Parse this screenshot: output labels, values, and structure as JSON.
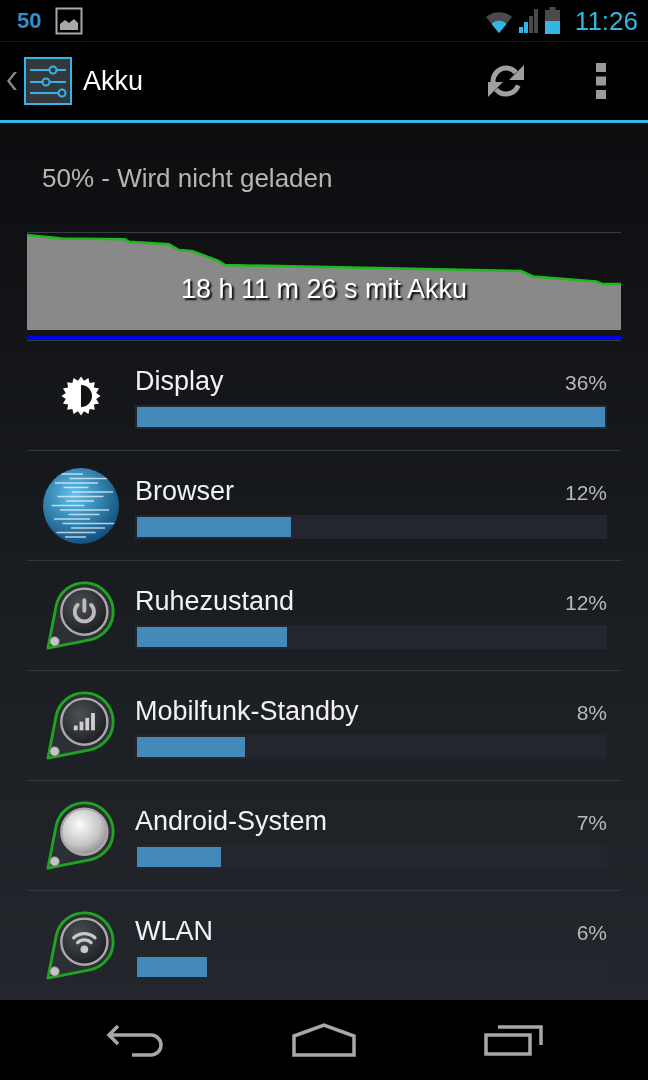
{
  "status_bar": {
    "notification": "50",
    "time": "11:26"
  },
  "action_bar": {
    "title": "Akku"
  },
  "battery": {
    "status": "50% - Wird nicht geladen",
    "graph_caption": "18 h 11 m 26 s mit Akku"
  },
  "usage": [
    {
      "kind": "display",
      "name": "Display",
      "percent": "36%",
      "level": 1.0
    },
    {
      "kind": "app",
      "name": "Browser",
      "percent": "12%",
      "level": 0.33
    },
    {
      "kind": "power",
      "name": "Ruhezustand",
      "percent": "12%",
      "level": 0.32
    },
    {
      "kind": "cell",
      "name": "Mobilfunk-Standby",
      "percent": "8%",
      "level": 0.23
    },
    {
      "kind": "system",
      "name": "Android-System",
      "percent": "7%",
      "level": 0.18
    },
    {
      "kind": "wifi",
      "name": "WLAN",
      "percent": "6%",
      "level": 0.15
    }
  ]
}
